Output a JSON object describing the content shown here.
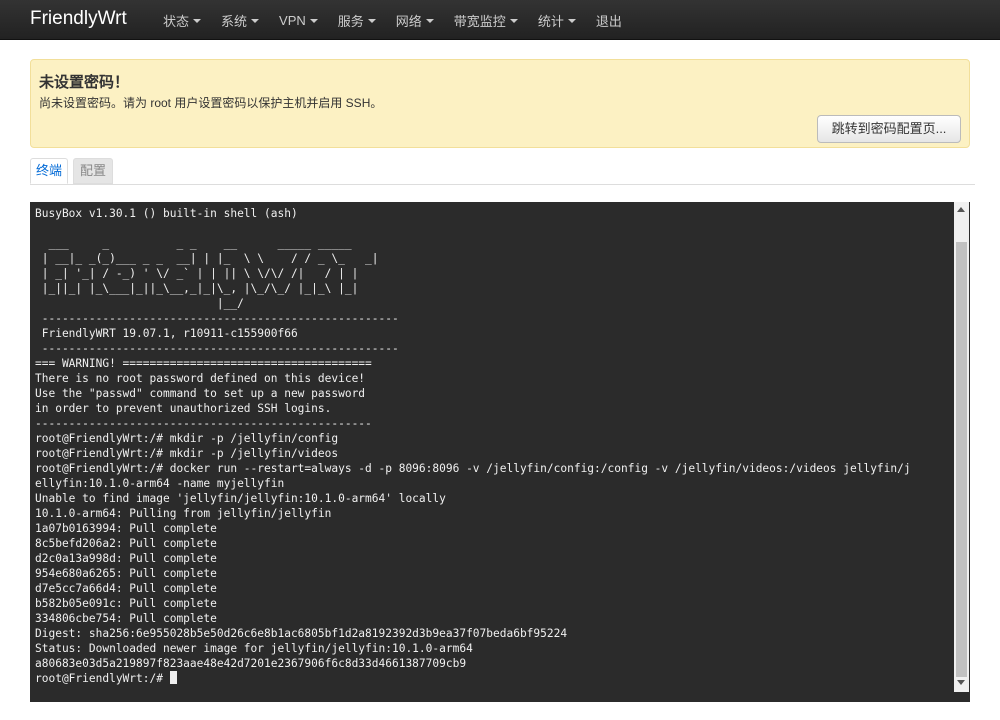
{
  "navbar": {
    "brand": "FriendlyWrt",
    "menu": [
      {
        "label": "状态",
        "dropdown": true
      },
      {
        "label": "系统",
        "dropdown": true
      },
      {
        "label": "VPN",
        "dropdown": true
      },
      {
        "label": "服务",
        "dropdown": true
      },
      {
        "label": "网络",
        "dropdown": true
      },
      {
        "label": "带宽监控",
        "dropdown": true
      },
      {
        "label": "统计",
        "dropdown": true
      },
      {
        "label": "退出",
        "dropdown": false
      }
    ]
  },
  "alert": {
    "title": "未设置密码！",
    "text": "尚未设置密码。请为 root 用户设置密码以保护主机并启用 SSH。",
    "button_label": "跳转到密码配置页..."
  },
  "tabs": [
    {
      "label": "终端",
      "active": true
    },
    {
      "label": "配置",
      "active": false
    }
  ],
  "terminal": {
    "lines": [
      "BusyBox v1.30.1 () built-in shell (ash)",
      "",
      "  ___     _          _ _    __      _____ _____",
      " | __|_ _(_)___ _ _  __| | |_  \\ \\    / / _ \\_   _|",
      " | _| '_| / -_) ' \\/ _` | | || \\ \\/\\/ /|   / | |",
      " |_||_| |_\\___|_||_\\__,_|_|\\_, |\\_/\\_/ |_|_\\ |_|",
      "                           |__/",
      " -----------------------------------------------------",
      " FriendlyWRT 19.07.1, r10911-c155900f66",
      " -----------------------------------------------------",
      "=== WARNING! =====================================",
      "There is no root password defined on this device!",
      "Use the \"passwd\" command to set up a new password",
      "in order to prevent unauthorized SSH logins.",
      "--------------------------------------------------",
      "root@FriendlyWrt:/# mkdir -p /jellyfin/config",
      "root@FriendlyWrt:/# mkdir -p /jellyfin/videos",
      "root@FriendlyWrt:/# docker run --restart=always -d -p 8096:8096 -v /jellyfin/config:/config -v /jellyfin/videos:/videos jellyfin/j",
      "ellyfin:10.1.0-arm64 -name myjellyfin",
      "Unable to find image 'jellyfin/jellyfin:10.1.0-arm64' locally",
      "10.1.0-arm64: Pulling from jellyfin/jellyfin",
      "1a07b0163994: Pull complete",
      "8c5befd206a2: Pull complete",
      "d2c0a13a998d: Pull complete",
      "954e680a6265: Pull complete",
      "d7e5cc7a66d4: Pull complete",
      "b582b05e091c: Pull complete",
      "334806cbe754: Pull complete",
      "Digest: sha256:6e955028b5e50d26c6e8b1ac6805bf1d2a8192392d3b9ea37f07beda6bf95224",
      "Status: Downloaded newer image for jellyfin/jellyfin:10.1.0-arm64",
      "a80683e03d5a219897f823aae48e42d7201e2367906f6c8d33d4661387709cb9"
    ],
    "prompt": "root@FriendlyWrt:/# "
  },
  "icons": {
    "dropdown": "caret-down-icon",
    "scroll_up": "scroll-up-arrow-icon",
    "scroll_down": "scroll-down-arrow-icon"
  }
}
